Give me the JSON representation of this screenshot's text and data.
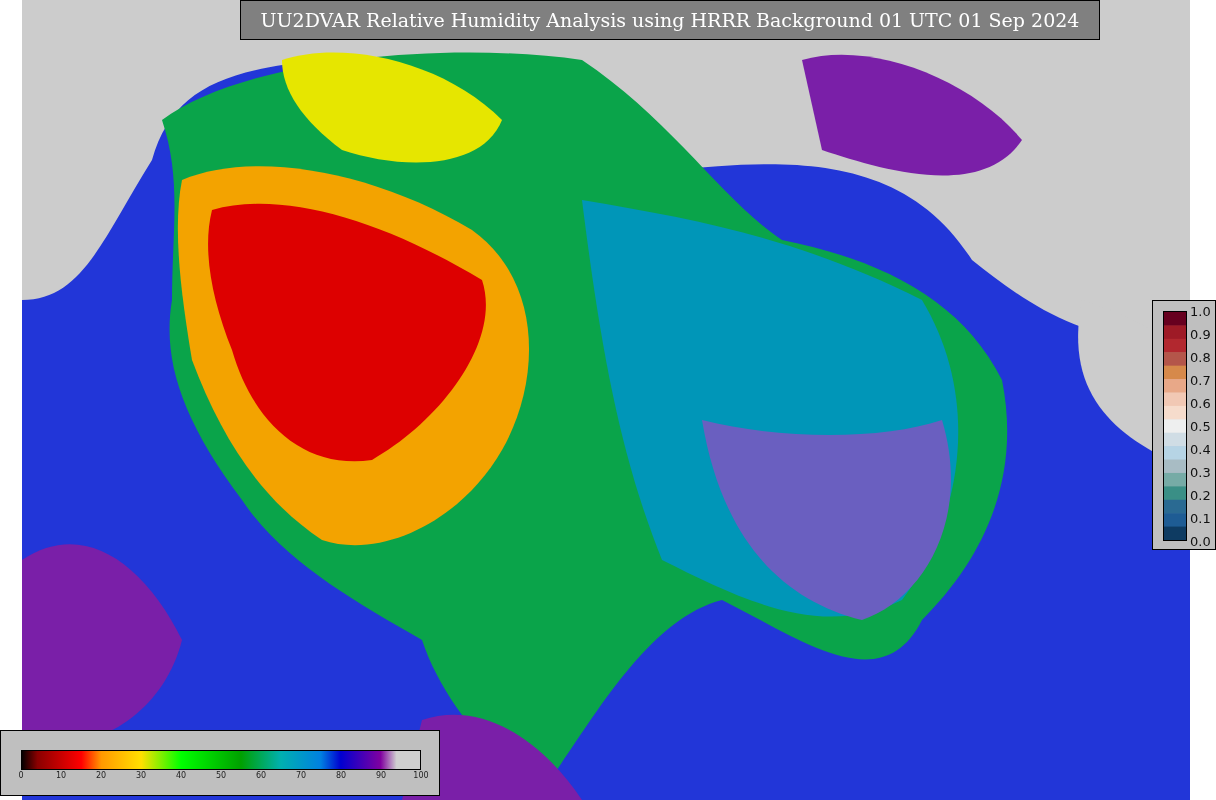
{
  "title": "UU2DVAR Relative Humidity Analysis using HRRR Background 01 UTC 01 Sep 2024",
  "humidity_colorbar": {
    "ticks": [
      "0",
      "10",
      "20",
      "30",
      "40",
      "50",
      "60",
      "70",
      "80",
      "90",
      "100"
    ]
  },
  "observation_colorbar": {
    "ticks": [
      "1.0",
      "0.9",
      "0.8",
      "0.7",
      "0.6",
      "0.5",
      "0.4",
      "0.3",
      "0.2",
      "0.1",
      "0.0"
    ]
  }
}
